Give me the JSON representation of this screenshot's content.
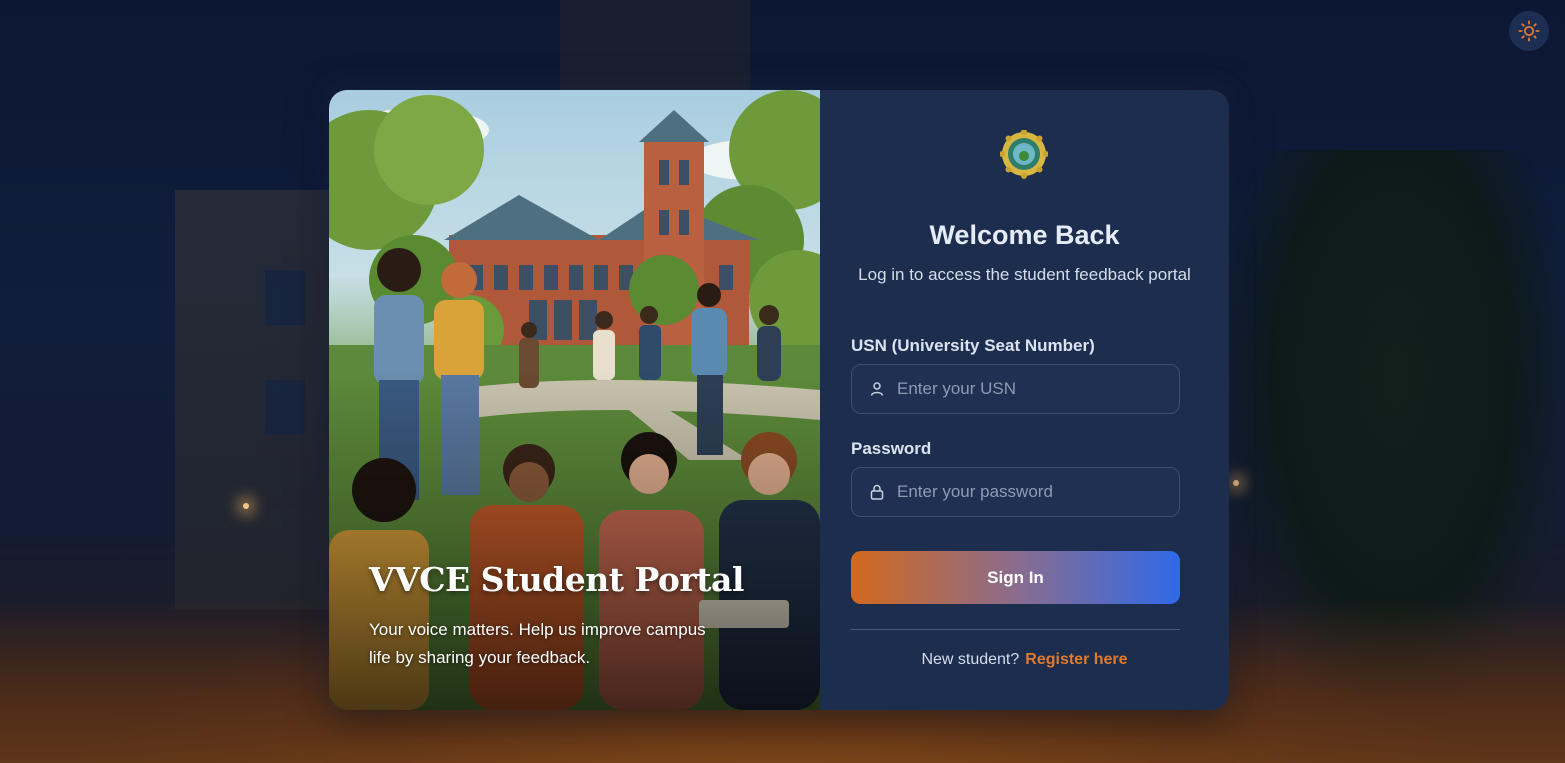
{
  "hero": {
    "title": "VVCE Student Portal",
    "subtitle": "Your voice matters. Help us improve campus life by sharing your feedback."
  },
  "login": {
    "heading": "Welcome Back",
    "tagline": "Log in to access the student feedback portal",
    "usn_label": "USN (University Seat Number)",
    "usn_placeholder": "Enter your USN",
    "usn_value": "",
    "password_label": "Password",
    "password_placeholder": "Enter your password",
    "password_value": "",
    "signin_label": "Sign In",
    "new_student_text": "New student?",
    "register_link": "Register here"
  },
  "icons": {
    "theme_toggle": "sun-icon",
    "usn_field": "user-icon",
    "password_field": "lock-icon",
    "logo": "college-emblem-icon"
  },
  "colors": {
    "accent_orange": "#e07a2c",
    "accent_blue": "#2f6ae8",
    "panel_bg": "#1d2d4e"
  }
}
